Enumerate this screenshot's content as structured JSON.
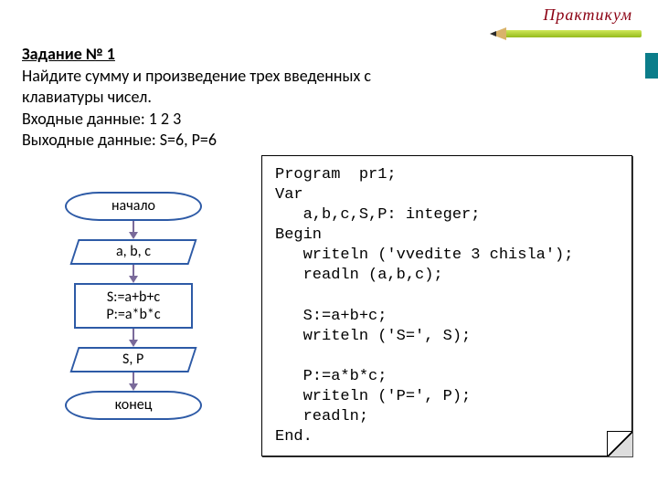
{
  "logo": {
    "brand": "Практикум"
  },
  "task": {
    "title": "Задание № 1",
    "desc1": "Найдите сумму и произведение трех введенных с",
    "desc2": "клавиатуры чисел.",
    "input_label": "Входные данные:  1 2 3",
    "output_label": "Выходные данные: S=6, P=6"
  },
  "flow": {
    "start": "начало",
    "io1": "a, b, c",
    "proc1": "S:=a+b+c",
    "proc2": "P:=a*b*c",
    "io2": "S, P",
    "end": "конец"
  },
  "code": {
    "l1": "Program  pr1;",
    "l2": "Var",
    "l3": "   a,b,c,S,P: integer;",
    "l4": "Begin",
    "l5": "   writeln ('vvedite 3 chisla');",
    "l6": "   readln (a,b,c);",
    "l7": "",
    "l8": "   S:=a+b+c;",
    "l9": "   writeln ('S=', S);",
    "l10": "",
    "l11": "   P:=a*b*c;",
    "l12": "   writeln ('P=', P);",
    "l13": "   readln;",
    "l14": "End."
  }
}
